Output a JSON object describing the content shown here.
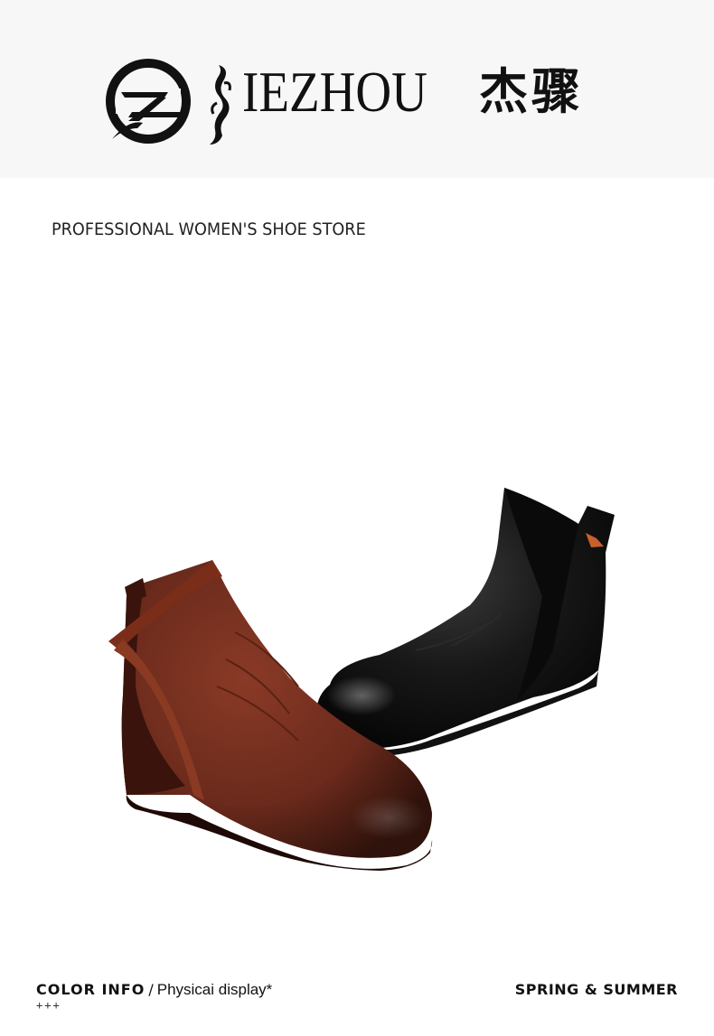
{
  "header": {
    "brand_name": "IEZHOU",
    "brand_chinese": "杰骤",
    "logo_icon": "jz-circle-monogram"
  },
  "tagline": "PROFESSIONAL WOMEN'S SHOE STORE",
  "product": {
    "items": [
      {
        "name": "brown-leather-ankle-boot",
        "color": "#6b2a1c"
      },
      {
        "name": "black-leather-ankle-boot",
        "color": "#141414"
      }
    ]
  },
  "footer": {
    "color_info": "COLOR INFO",
    "separator": "/",
    "physical_display": "Physicai display*",
    "plus_marks": "+++",
    "season": "SPRING & SUMMER"
  }
}
